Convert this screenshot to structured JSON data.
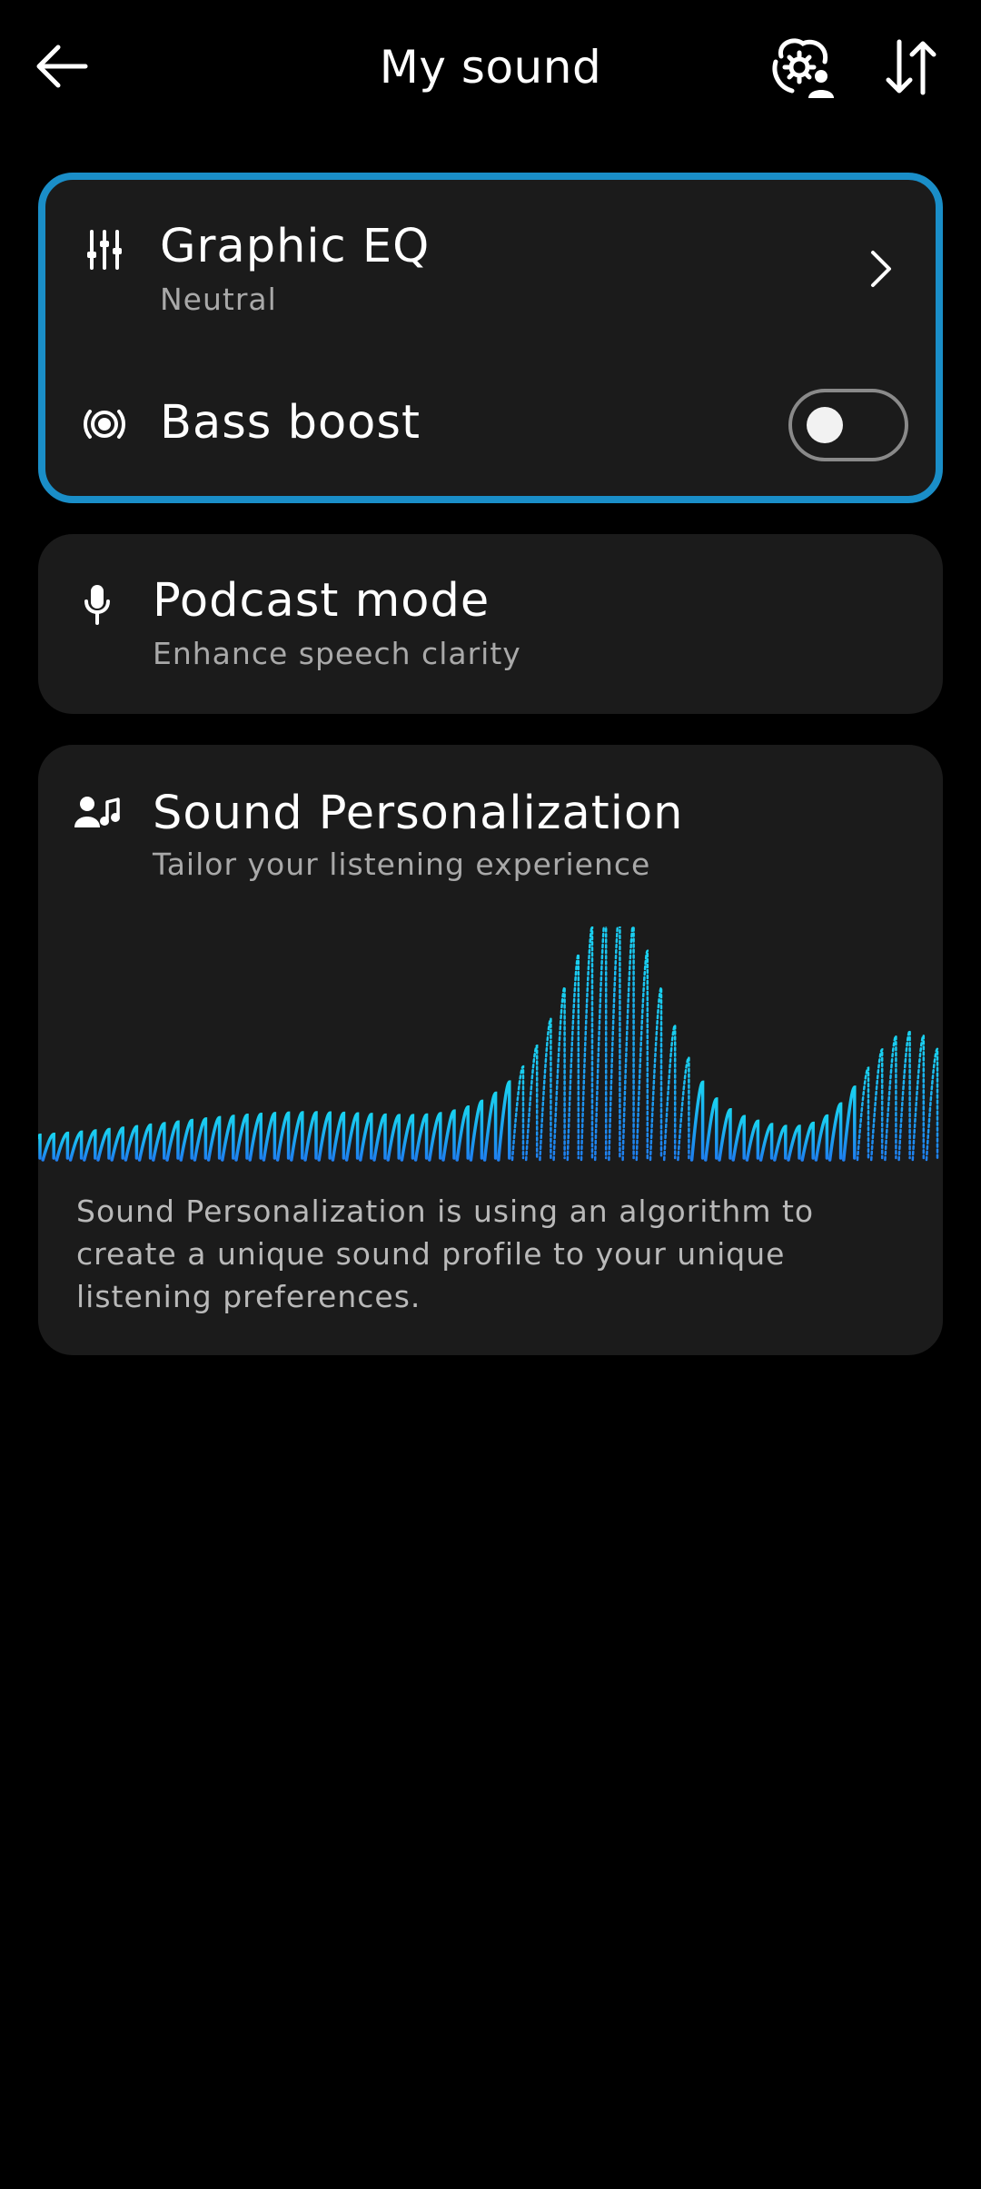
{
  "header": {
    "back_icon": "arrow-left-icon",
    "title": "My sound",
    "sync_icon": "cloud-settings-user-icon",
    "sort_icon": "sort-arrows-icon"
  },
  "sound_card": {
    "graphic_eq": {
      "icon": "equalizer-sliders-icon",
      "title": "Graphic EQ",
      "subtitle": "Neutral",
      "chevron_icon": "chevron-right-icon"
    },
    "bass_boost": {
      "icon": "speaker-waves-icon",
      "title": "Bass boost",
      "enabled": false
    }
  },
  "podcast_card": {
    "icon": "microphone-icon",
    "title": "Podcast mode",
    "subtitle": "Enhance speech clarity"
  },
  "personalization_card": {
    "icon": "user-music-icon",
    "title": "Sound Personalization",
    "subtitle": "Tailor your listening experience",
    "description": "Sound Personalization is using an algorithm to create a unique sound profile to your unique listening preferences."
  },
  "colors": {
    "background": "#000000",
    "card": "#1b1b1b",
    "accent": "#1a8ec8",
    "wave_blue": "#1e7ff0",
    "wave_cyan": "#19d2f0",
    "secondary_text": "#a9a9a9"
  }
}
